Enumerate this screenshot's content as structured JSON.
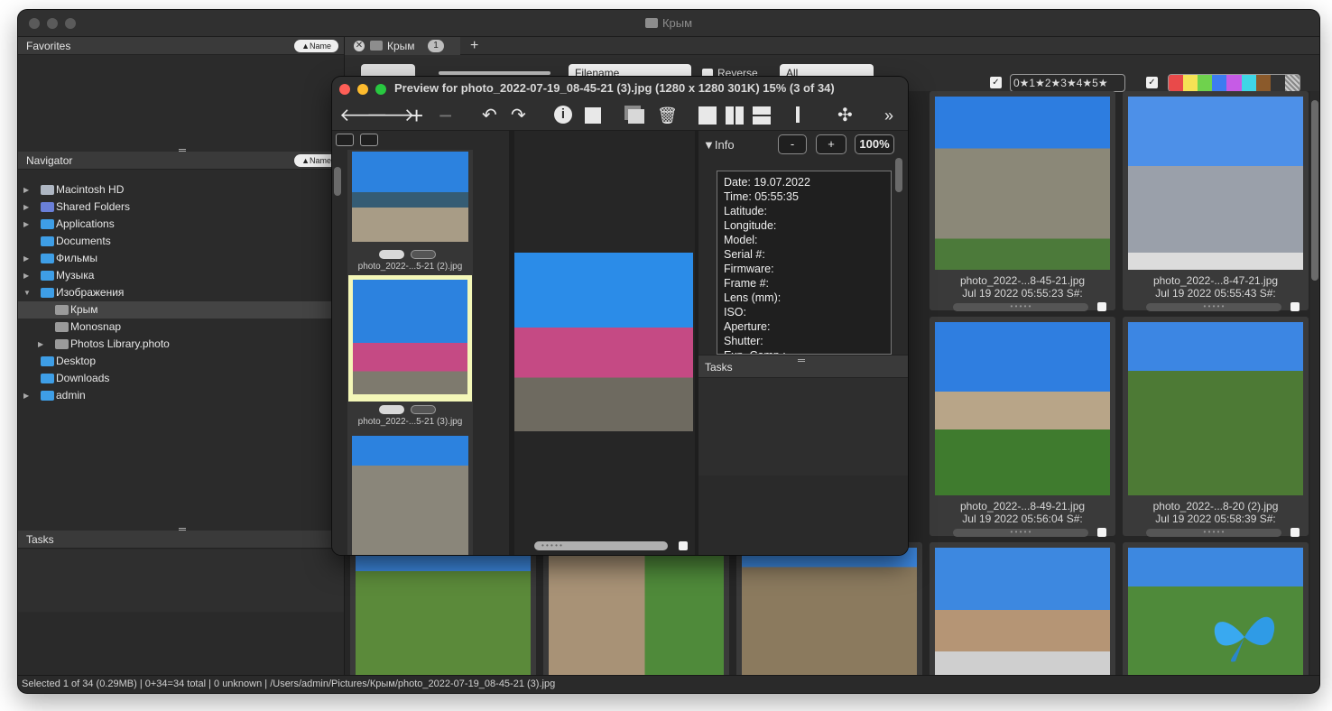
{
  "window": {
    "title": "Крым"
  },
  "sidebar": {
    "favorites_label": "Favorites",
    "navigator_label": "Navigator",
    "tasks_label": "Tasks",
    "sort_label": "▲Name",
    "items": [
      {
        "label": "Macintosh HD"
      },
      {
        "label": "Shared Folders"
      },
      {
        "label": "Applications"
      },
      {
        "label": "Documents"
      },
      {
        "label": "Фильмы"
      },
      {
        "label": "Музыка"
      },
      {
        "label": "Изображения"
      },
      {
        "label": "Крым"
      },
      {
        "label": "Monosnap"
      },
      {
        "label": "Photos Library.photo"
      },
      {
        "label": "Desktop"
      },
      {
        "label": "Downloads"
      },
      {
        "label": "admin"
      }
    ]
  },
  "tabs": [
    {
      "label": "Крым",
      "count": "1"
    }
  ],
  "toolbar": {
    "sort_field": "Filename",
    "reverse_label": "Reverse",
    "filter": "All",
    "rating_filter": "0★1★2★3★4★5★"
  },
  "colors": {
    "labels": [
      "#e94a4a",
      "#f5e255",
      "#6fd24d",
      "#3d7cf0",
      "#c65be6",
      "#3fd6e6",
      "#8b5a2b",
      "#333333"
    ]
  },
  "thumbs": [
    {
      "name": "photo_2022-...8-45-21.jpg",
      "date": "Jul 19 2022 05:55:23 S#:"
    },
    {
      "name": "photo_2022-...8-47-21.jpg",
      "date": "Jul 19 2022 05:55:43 S#:"
    },
    {
      "name": "photo_2022-...8-49-21.jpg",
      "date": "Jul 19 2022 05:56:04 S#:"
    },
    {
      "name": "photo_2022-...8-20 (2).jpg",
      "date": "Jul 19 2022 05:58:39 S#:"
    }
  ],
  "status": "Selected 1 of 34 (0.29MB) | 0+34=34 total | 0 unknown | /Users/admin/Pictures/Крым/photo_2022-07-19_08-45-21 (3).jpg",
  "preview": {
    "title": "Preview for photo_2022-07-19_08-45-21 (3).jpg (1280 x 1280 301K) 15% (3 of 34)",
    "strip": [
      {
        "name": "photo_2022-...5-21 (2).jpg"
      },
      {
        "name": "photo_2022-...5-21 (3).jpg"
      }
    ],
    "info_label": "Info",
    "zoom_minus": "-",
    "zoom_plus": "+",
    "zoom": "100%",
    "info": [
      "Date: 19.07.2022",
      "Time: 05:55:35",
      "Latitude:",
      "Longitude:",
      "Model:",
      "Serial #:",
      "Firmware:",
      "Frame #:",
      "Lens (mm):",
      "ISO:",
      "Aperture:",
      "Shutter:",
      "Exp. Comp.:"
    ],
    "tasks_label": "Tasks"
  }
}
